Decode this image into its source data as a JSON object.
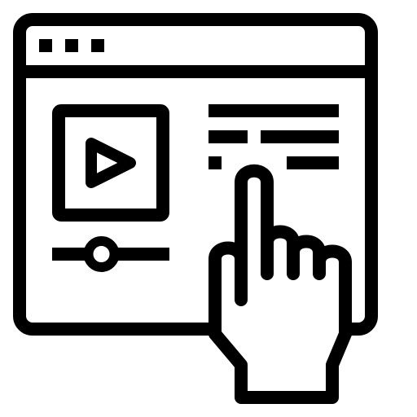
{
  "icon": {
    "semantic": "web-video-player-touch-icon",
    "stroke_color": "#000000",
    "fill_color": "#ffffff",
    "browser_dots_count": 3,
    "video_progress_fraction": 0.42
  }
}
